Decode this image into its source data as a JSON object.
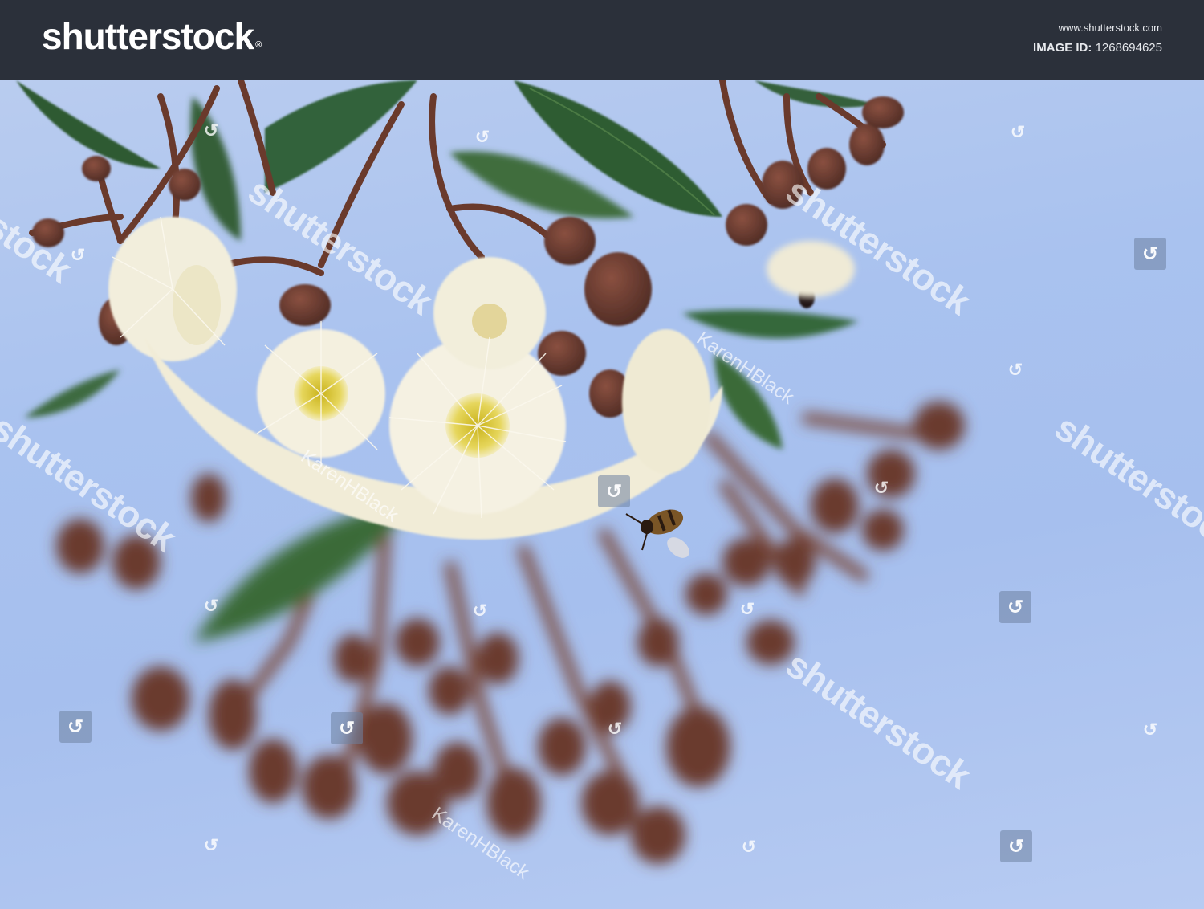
{
  "header": {
    "logo_text": "shutterstock",
    "logo_mark": "®",
    "site_url": "www.shutterstock.com",
    "image_id_label": "IMAGE ID:",
    "image_id_value": "1268694625"
  },
  "watermark": {
    "brand": "shutterstock",
    "contributor": "KarenHBlack",
    "icon": "shutterstock-logo-icon"
  },
  "colors": {
    "bar": "#2b303a",
    "sky": "#a9c2ef",
    "blossom": "#f3eedb",
    "stamen_center": "#e1cc4c",
    "bud": "#6b3b2e",
    "leaf": "#3c6a3a"
  }
}
